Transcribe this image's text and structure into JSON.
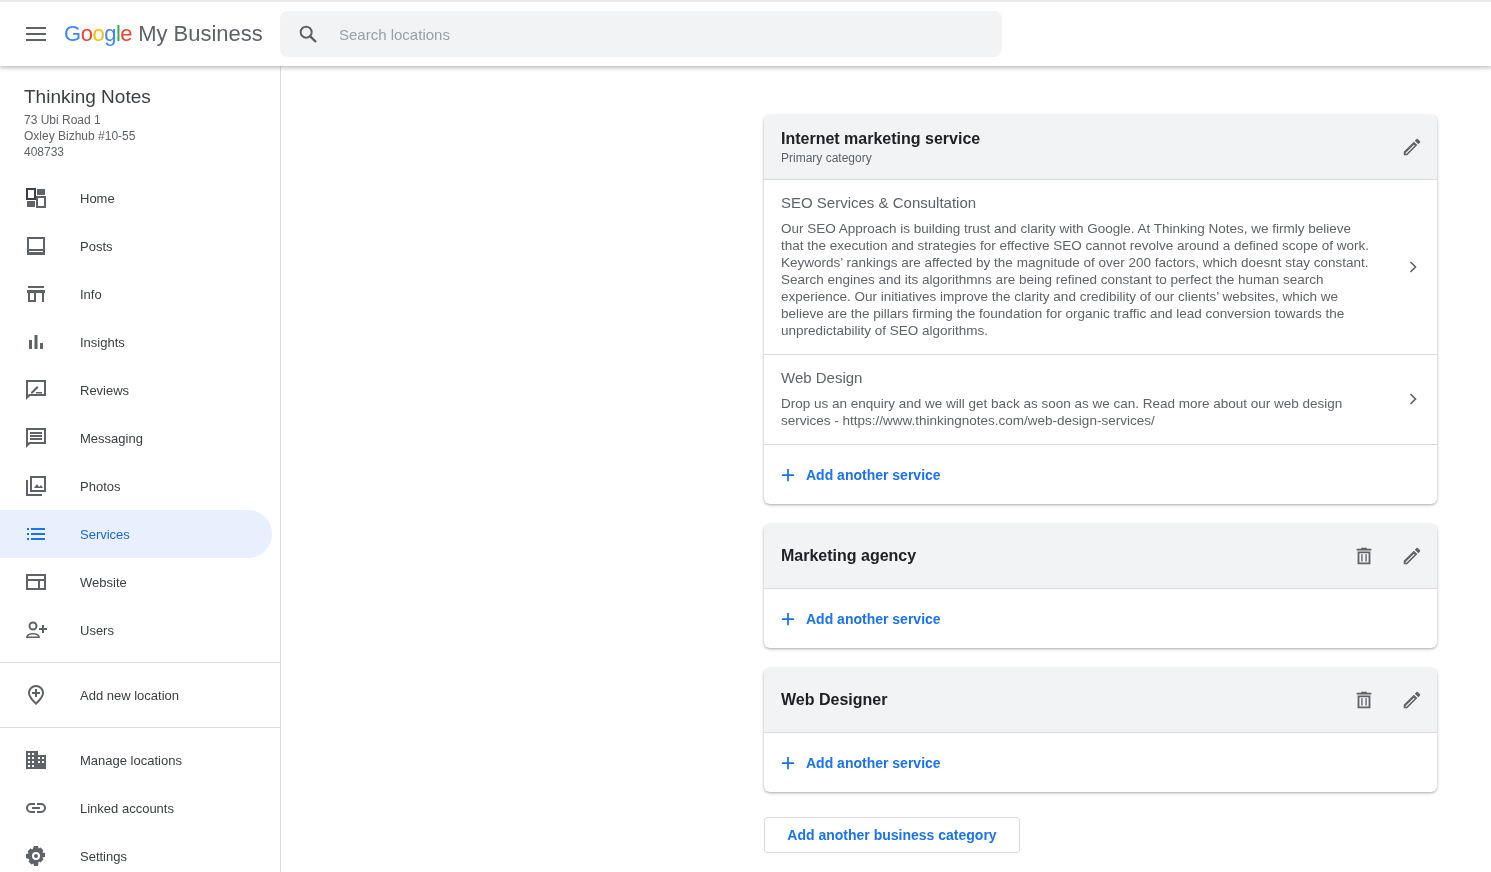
{
  "header": {
    "logo_brand": "Google",
    "logo_product": "My Business",
    "search": {
      "placeholder": "Search locations"
    }
  },
  "business": {
    "name": "Thinking Notes",
    "address_lines": [
      "73 Ubi Road 1",
      "Oxley Bizhub #10-55",
      "408733"
    ]
  },
  "sidebar": {
    "groups": [
      [
        {
          "label": "Home",
          "kind": "dashboard",
          "selected": false
        },
        {
          "label": "Posts",
          "kind": "posts",
          "selected": false
        },
        {
          "label": "Info",
          "kind": "store",
          "selected": false
        },
        {
          "label": "Insights",
          "kind": "bars",
          "selected": false
        },
        {
          "label": "Reviews",
          "kind": "review",
          "selected": false
        },
        {
          "label": "Messaging",
          "kind": "message",
          "selected": false
        },
        {
          "label": "Photos",
          "kind": "photos",
          "selected": false
        },
        {
          "label": "Services",
          "kind": "list",
          "selected": true
        },
        {
          "label": "Website",
          "kind": "web",
          "selected": false
        },
        {
          "label": "Users",
          "kind": "user-add",
          "selected": false
        }
      ],
      [
        {
          "label": "Add new location",
          "kind": "pin-add",
          "selected": false
        }
      ],
      [
        {
          "label": "Manage locations",
          "kind": "building",
          "selected": false
        },
        {
          "label": "Linked accounts",
          "kind": "link",
          "selected": false
        },
        {
          "label": "Settings",
          "kind": "gear",
          "selected": false
        }
      ]
    ]
  },
  "categories": [
    {
      "name": "Internet marketing service",
      "subtitle": "Primary category",
      "deletable": false,
      "services": [
        {
          "name": "SEO Services & Consultation",
          "description": "Our SEO Approach is building trust and clarity with Google. At Thinking Notes, we firmly believe that the execution and strategies for effective SEO cannot revolve around a defined scope of work. Keywords’ rankings are affected by the magnitude of over 200 factors, which doesnt stay constant. Search engines and its algorithmns are being refined constant to perfect the human search experience. Our initiatives improve the clarity and credibility of our clients’ websites, which we believe are the pillars firming the foundation for organic traffic and lead conversion towards the unpredictability of SEO algorithms."
        },
        {
          "name": "Web Design",
          "description": "Drop us an enquiry and we will get back as soon as we can. Read more about our web design services - https://www.thinkingnotes.com/web-design-services/"
        }
      ],
      "add_label": "Add another service"
    },
    {
      "name": "Marketing agency",
      "deletable": true,
      "add_label": "Add another service"
    },
    {
      "name": "Web Designer",
      "deletable": true,
      "add_label": "Add another service"
    }
  ],
  "add_category_button": "Add another business category"
}
